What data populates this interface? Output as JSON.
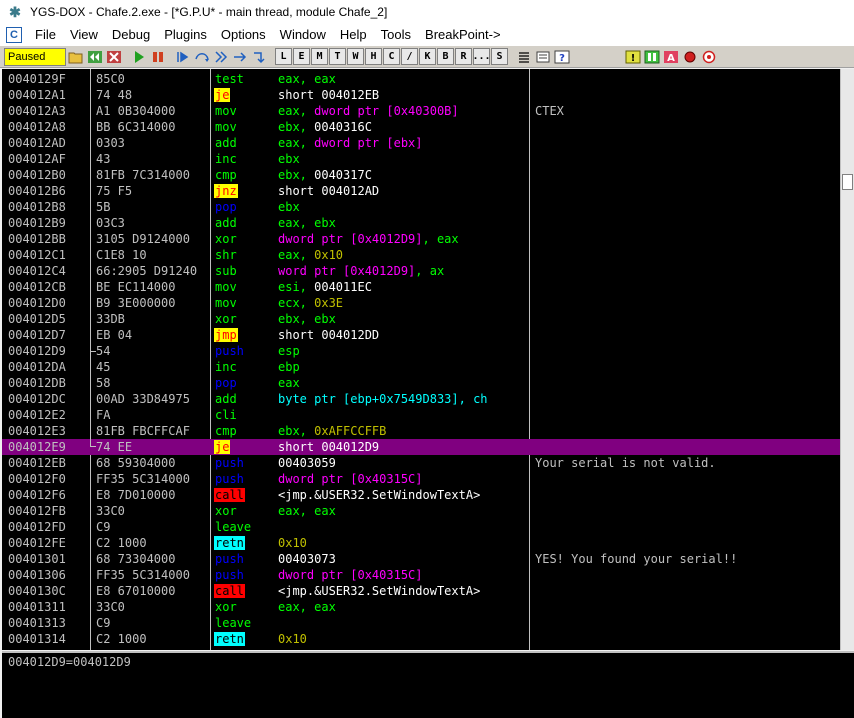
{
  "window": {
    "title": "YGS-DOX - Chafe.2.exe - [*G.P.U* - main thread, module Chafe_2]"
  },
  "menu": {
    "items": [
      "File",
      "View",
      "Debug",
      "Plugins",
      "Options",
      "Window",
      "Help",
      "Tools",
      "BreakPoint->"
    ]
  },
  "toolbar": {
    "status": "Paused",
    "letters": [
      "L",
      "E",
      "M",
      "T",
      "W",
      "H",
      "C",
      "/",
      "K",
      "B",
      "R",
      "...",
      "S"
    ]
  },
  "colors": {
    "background": "#000000",
    "selected_row": "#800080",
    "mnemonic": "#00ff00",
    "jump_highlight": "#ffff00",
    "call_highlight": "#ff0000",
    "retn_highlight": "#00ffff",
    "memory_operand": "#ff00ff",
    "stack_op": "#0000ff",
    "paused_badge": "#ffff00"
  },
  "disassembly": [
    {
      "addr": "0040129F",
      "hex": "85C0",
      "mn": "test",
      "ops": [
        {
          "t": "eax, eax",
          "c": "reg"
        }
      ],
      "cmt": ""
    },
    {
      "addr": "004012A1",
      "hex": "74 48",
      "mn": "je",
      "kind": "jcc",
      "ops": [
        {
          "t": "short 004012EB",
          "c": "wht"
        }
      ],
      "cmt": ""
    },
    {
      "addr": "004012A3",
      "hex": "A1 0B304000",
      "mn": "mov",
      "ops": [
        {
          "t": "eax, ",
          "c": "reg"
        },
        {
          "t": "dword ptr [0x40300B]",
          "c": "mem"
        }
      ],
      "cmt": "CTEX"
    },
    {
      "addr": "004012A8",
      "hex": "BB 6C314000",
      "mn": "mov",
      "ops": [
        {
          "t": "ebx, ",
          "c": "reg"
        },
        {
          "t": "0040316C",
          "c": "wht"
        }
      ],
      "cmt": ""
    },
    {
      "addr": "004012AD",
      "hex": "0303",
      "mn": "add",
      "ops": [
        {
          "t": "eax, ",
          "c": "reg"
        },
        {
          "t": "dword ptr [ebx]",
          "c": "mem"
        }
      ],
      "cmt": ""
    },
    {
      "addr": "004012AF",
      "hex": "43",
      "mn": "inc",
      "ops": [
        {
          "t": "ebx",
          "c": "reg"
        }
      ],
      "cmt": ""
    },
    {
      "addr": "004012B0",
      "hex": "81FB 7C314000",
      "mn": "cmp",
      "ops": [
        {
          "t": "ebx, ",
          "c": "reg"
        },
        {
          "t": "0040317C",
          "c": "wht"
        }
      ],
      "cmt": ""
    },
    {
      "addr": "004012B6",
      "hex": "75 F5",
      "mn": "jnz",
      "kind": "jcc",
      "ops": [
        {
          "t": "short 004012AD",
          "c": "wht"
        }
      ],
      "cmt": "",
      "arrow": true
    },
    {
      "addr": "004012B8",
      "hex": "5B",
      "mn": "pop",
      "kind": "blue",
      "ops": [
        {
          "t": "ebx",
          "c": "reg"
        }
      ],
      "cmt": ""
    },
    {
      "addr": "004012B9",
      "hex": "03C3",
      "mn": "add",
      "ops": [
        {
          "t": "eax, ebx",
          "c": "reg"
        }
      ],
      "cmt": ""
    },
    {
      "addr": "004012BB",
      "hex": "3105 D9124000",
      "mn": "xor",
      "ops": [
        {
          "t": "dword ptr [0x4012D9]",
          "c": "mem"
        },
        {
          "t": ", eax",
          "c": "reg"
        }
      ],
      "cmt": ""
    },
    {
      "addr": "004012C1",
      "hex": "C1E8 10",
      "mn": "shr",
      "ops": [
        {
          "t": "eax, ",
          "c": "reg"
        },
        {
          "t": "0x10",
          "c": "num"
        }
      ],
      "cmt": ""
    },
    {
      "addr": "004012C4",
      "hex": "66:2905 D91240",
      "mn": "sub",
      "ops": [
        {
          "t": "word ptr [0x4012D9]",
          "c": "mem"
        },
        {
          "t": ", ax",
          "c": "reg"
        }
      ],
      "cmt": ""
    },
    {
      "addr": "004012CB",
      "hex": "BE EC114000",
      "mn": "mov",
      "ops": [
        {
          "t": "esi, ",
          "c": "reg"
        },
        {
          "t": "004011EC",
          "c": "wht"
        }
      ],
      "cmt": ""
    },
    {
      "addr": "004012D0",
      "hex": "B9 3E000000",
      "mn": "mov",
      "ops": [
        {
          "t": "ecx, ",
          "c": "reg"
        },
        {
          "t": "0x3E",
          "c": "num"
        }
      ],
      "cmt": ""
    },
    {
      "addr": "004012D5",
      "hex": "33DB",
      "mn": "xor",
      "ops": [
        {
          "t": "ebx, ebx",
          "c": "reg"
        }
      ],
      "cmt": ""
    },
    {
      "addr": "004012D7",
      "hex": "EB 04",
      "mn": "jmp",
      "kind": "jcc",
      "ops": [
        {
          "t": "short 004012DD",
          "c": "wht"
        }
      ],
      "cmt": ""
    },
    {
      "addr": "004012D9",
      "hex": "54",
      "mn": "push",
      "kind": "blue",
      "ops": [
        {
          "t": "esp",
          "c": "reg"
        }
      ],
      "cmt": "",
      "arrow": true
    },
    {
      "addr": "004012DA",
      "hex": "45",
      "mn": "inc",
      "ops": [
        {
          "t": "ebp",
          "c": "reg"
        }
      ],
      "cmt": ""
    },
    {
      "addr": "004012DB",
      "hex": "58",
      "mn": "pop",
      "kind": "blue",
      "ops": [
        {
          "t": "eax",
          "c": "reg"
        }
      ],
      "cmt": ""
    },
    {
      "addr": "004012DC",
      "hex": "00AD 33D84975",
      "mn": "add",
      "ops": [
        {
          "t": "byte ptr [ebp+0x7549D833], ch",
          "c": "ptr"
        }
      ],
      "cmt": ""
    },
    {
      "addr": "004012E2",
      "hex": "FA",
      "mn": "cli",
      "ops": [],
      "cmt": ""
    },
    {
      "addr": "004012E3",
      "hex": "81FB FBCFFCAF",
      "mn": "cmp",
      "ops": [
        {
          "t": "ebx, ",
          "c": "reg"
        },
        {
          "t": "0xAFFCCFFB",
          "c": "num"
        }
      ],
      "cmt": ""
    },
    {
      "addr": "004012E9",
      "hex": "74 EE",
      "mn": "je",
      "kind": "jcc",
      "ops": [
        {
          "t": "short 004012D9",
          "c": "wht"
        }
      ],
      "cmt": "",
      "selected": true,
      "arrow": true
    },
    {
      "addr": "004012EB",
      "hex": "68 59304000",
      "mn": "push",
      "kind": "blue",
      "ops": [
        {
          "t": "00403059",
          "c": "wht"
        }
      ],
      "cmt": "Your serial is not valid."
    },
    {
      "addr": "004012F0",
      "hex": "FF35 5C314000",
      "mn": "push",
      "kind": "blue",
      "ops": [
        {
          "t": "dword ptr [0x40315C]",
          "c": "mem"
        }
      ],
      "cmt": ""
    },
    {
      "addr": "004012F6",
      "hex": "E8 7D010000",
      "mn": "call",
      "kind": "call",
      "ops": [
        {
          "t": "<jmp.&USER32.SetWindowTextA>",
          "c": "wht"
        }
      ],
      "cmt": ""
    },
    {
      "addr": "004012FB",
      "hex": "33C0",
      "mn": "xor",
      "ops": [
        {
          "t": "eax, eax",
          "c": "reg"
        }
      ],
      "cmt": ""
    },
    {
      "addr": "004012FD",
      "hex": "C9",
      "mn": "leave",
      "ops": [],
      "cmt": ""
    },
    {
      "addr": "004012FE",
      "hex": "C2 1000",
      "mn": "retn",
      "kind": "retn",
      "ops": [
        {
          "t": "0x10",
          "c": "num"
        }
      ],
      "cmt": ""
    },
    {
      "addr": "00401301",
      "hex": "68 73304000",
      "mn": "push",
      "kind": "blue",
      "ops": [
        {
          "t": "00403073",
          "c": "wht"
        }
      ],
      "cmt": "YES! You found your serial!!"
    },
    {
      "addr": "00401306",
      "hex": "FF35 5C314000",
      "mn": "push",
      "kind": "blue",
      "ops": [
        {
          "t": "dword ptr [0x40315C]",
          "c": "mem"
        }
      ],
      "cmt": ""
    },
    {
      "addr": "0040130C",
      "hex": "E8 67010000",
      "mn": "call",
      "kind": "call",
      "ops": [
        {
          "t": "<jmp.&USER32.SetWindowTextA>",
          "c": "wht"
        }
      ],
      "cmt": ""
    },
    {
      "addr": "00401311",
      "hex": "33C0",
      "mn": "xor",
      "ops": [
        {
          "t": "eax, eax",
          "c": "reg"
        }
      ],
      "cmt": ""
    },
    {
      "addr": "00401313",
      "hex": "C9",
      "mn": "leave",
      "ops": [],
      "cmt": ""
    },
    {
      "addr": "00401314",
      "hex": "C2 1000",
      "mn": "retn",
      "kind": "retn",
      "ops": [
        {
          "t": "0x10",
          "c": "num"
        }
      ],
      "cmt": ""
    }
  ],
  "info": {
    "text": "004012D9=004012D9"
  }
}
